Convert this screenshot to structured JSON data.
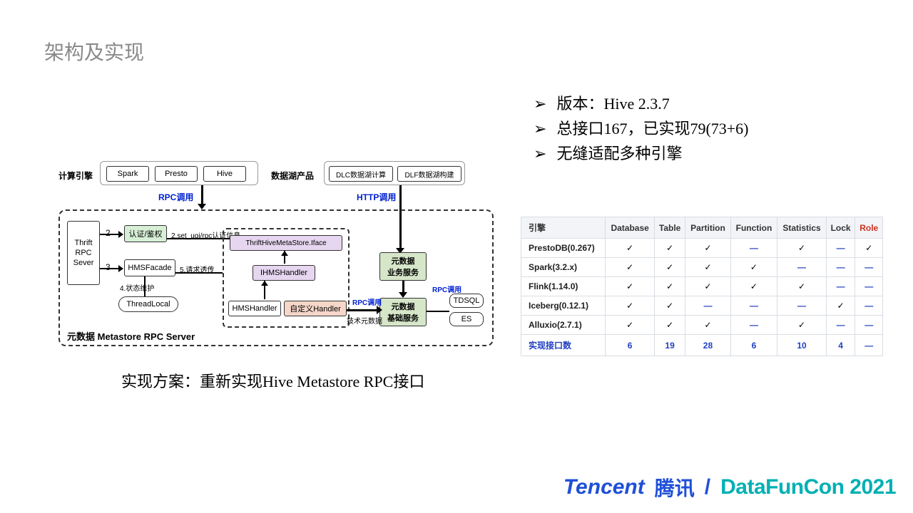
{
  "title": "架构及实现",
  "bullets": [
    "版本：Hive 2.3.7",
    "总接口167，已实现79(73+6)",
    "无缝适配多种引擎"
  ],
  "subtitle": "实现方案：重新实现Hive Metastore RPC接口",
  "diagram": {
    "label_engine": "计算引擎",
    "engines": [
      "Spark",
      "Presto",
      "Hive"
    ],
    "label_lake": "数据湖产品",
    "lake_products": [
      "DLC数据湖计算",
      "DLF数据湖构建"
    ],
    "rpc_call": "RPC调用",
    "http_call": "HTTP调用",
    "thrift_server_lines": [
      "Thrift",
      "RPC",
      "Sever"
    ],
    "auth": "认证/鉴权",
    "facade": "HMSFacade",
    "state": "4.状态维护",
    "threadlocal": "ThreadLocal",
    "set_ugi": "2.set_ugi/rpc认证信息",
    "forward": "5.请求透传",
    "thrift_iface": "ThriftHiveMetaStore.Iface",
    "ihms": "IHMSHandler",
    "hms_handler": "HMSHandler",
    "custom_handler": "自定义Handler",
    "biz_lines": [
      "元数据",
      "业务服务"
    ],
    "base_lines": [
      "元数据",
      "基础服务"
    ],
    "tech_meta": "技术元数据",
    "tdsql": "TDSQL",
    "es": "ES",
    "server_label": "元数据 Metastore RPC Server"
  },
  "table": {
    "headers": [
      "引擎",
      "Database",
      "Table",
      "Partition",
      "Function",
      "Statistics",
      "Lock",
      "Role"
    ],
    "rows": [
      [
        "PrestoDB(0.267)",
        "✓",
        "✓",
        "✓",
        "—",
        "✓",
        "—",
        "✓"
      ],
      [
        "Spark(3.2.x)",
        "✓",
        "✓",
        "✓",
        "✓",
        "—",
        "—",
        "—"
      ],
      [
        "Flink(1.14.0)",
        "✓",
        "✓",
        "✓",
        "✓",
        "✓",
        "—",
        "—"
      ],
      [
        "Iceberg(0.12.1)",
        "✓",
        "✓",
        "—",
        "—",
        "—",
        "✓",
        "—"
      ],
      [
        "Alluxio(2.7.1)",
        "✓",
        "✓",
        "✓",
        "—",
        "✓",
        "—",
        "—"
      ],
      [
        "实现接口数",
        "6",
        "19",
        "28",
        "6",
        "10",
        "4",
        "—"
      ]
    ]
  },
  "footer": {
    "tencent_en": "Tencent",
    "tencent_cn": "腾讯",
    "datafun": "DataFunCon 2021"
  }
}
